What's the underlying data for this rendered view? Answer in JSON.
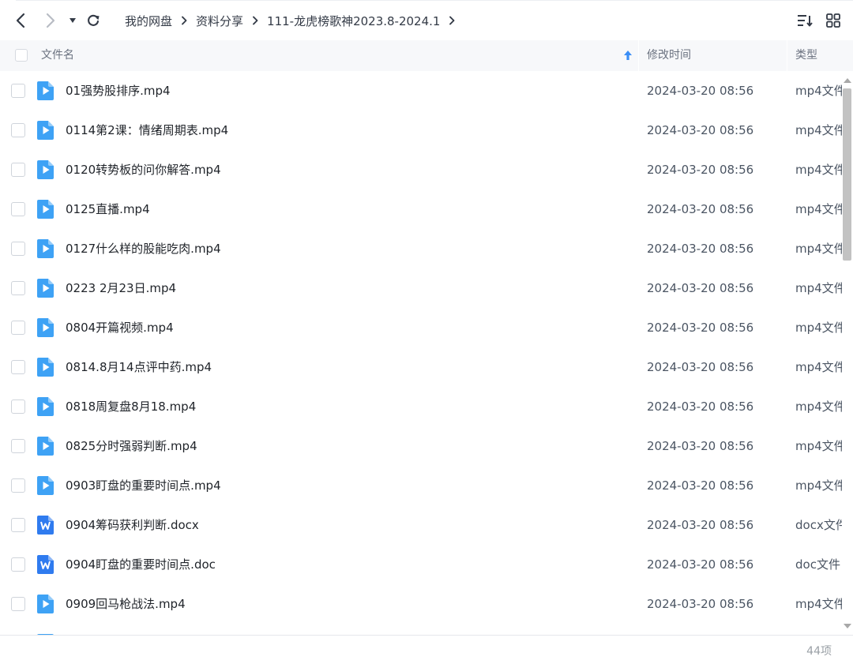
{
  "toolbar": {
    "breadcrumbs": [
      "我的网盘",
      "资料分享",
      "111-龙虎榜歌神2023.8-2024.1"
    ]
  },
  "columns": {
    "name": "文件名",
    "time": "修改时间",
    "type": "类型"
  },
  "files": [
    {
      "name": "01强势股排序.mp4",
      "time": "2024-03-20 08:56",
      "type": "mp4文件",
      "kind": "video"
    },
    {
      "name": "0114第2课：情绪周期表.mp4",
      "time": "2024-03-20 08:56",
      "type": "mp4文件",
      "kind": "video"
    },
    {
      "name": "0120转势板的问你解答.mp4",
      "time": "2024-03-20 08:56",
      "type": "mp4文件",
      "kind": "video"
    },
    {
      "name": "0125直播.mp4",
      "time": "2024-03-20 08:56",
      "type": "mp4文件",
      "kind": "video"
    },
    {
      "name": "0127什么样的股能吃肉.mp4",
      "time": "2024-03-20 08:56",
      "type": "mp4文件",
      "kind": "video"
    },
    {
      "name": "0223 2月23日.mp4",
      "time": "2024-03-20 08:56",
      "type": "mp4文件",
      "kind": "video"
    },
    {
      "name": "0804开篇视频.mp4",
      "time": "2024-03-20 08:56",
      "type": "mp4文件",
      "kind": "video"
    },
    {
      "name": "0814.8月14点评中药.mp4",
      "time": "2024-03-20 08:56",
      "type": "mp4文件",
      "kind": "video"
    },
    {
      "name": "0818周复盘8月18.mp4",
      "time": "2024-03-20 08:56",
      "type": "mp4文件",
      "kind": "video"
    },
    {
      "name": "0825分时强弱判断.mp4",
      "time": "2024-03-20 08:56",
      "type": "mp4文件",
      "kind": "video"
    },
    {
      "name": "0903盯盘的重要时间点.mp4",
      "time": "2024-03-20 08:56",
      "type": "mp4文件",
      "kind": "video"
    },
    {
      "name": "0904筹码获利判断.docx",
      "time": "2024-03-20 08:56",
      "type": "docx文件",
      "kind": "word"
    },
    {
      "name": "0904盯盘的重要时间点.doc",
      "time": "2024-03-20 08:56",
      "type": "doc文件",
      "kind": "word"
    },
    {
      "name": "0909回马枪战法.mp4",
      "time": "2024-03-20 08:56",
      "type": "mp4文件",
      "kind": "video"
    }
  ],
  "footer": {
    "count": "44项"
  },
  "colors": {
    "video_icon": "#3ea2f5",
    "word_icon": "#2f7bef"
  }
}
